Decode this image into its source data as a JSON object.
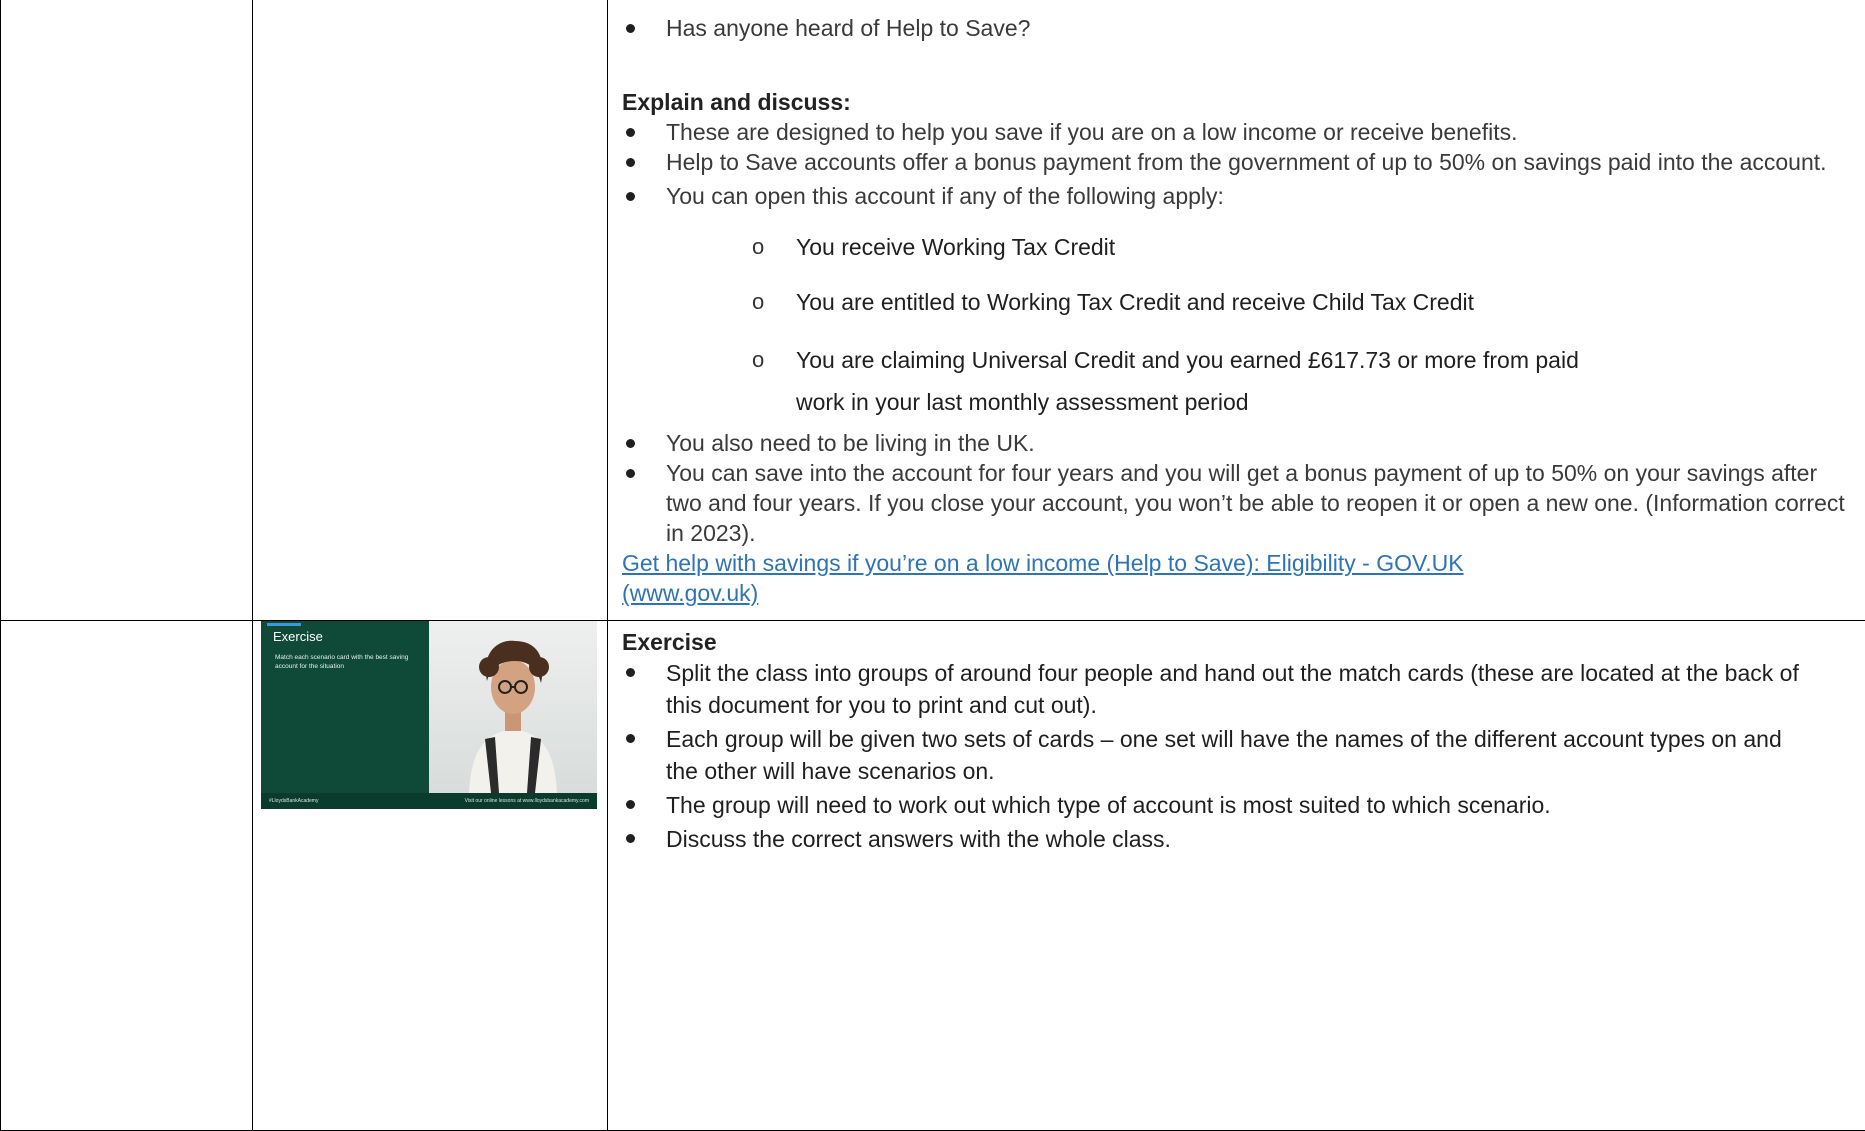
{
  "help_to_save": {
    "intro_bullet": "Has anyone heard of Help to Save?",
    "heading": "Explain and discuss:",
    "bullets": [
      "These are designed to help you save if you are on a low income or receive benefits.",
      "Help to Save accounts offer a bonus payment from the government of up to 50% on savings paid into the account.",
      "You can open this account if any of the following apply:"
    ],
    "conditions": [
      "You receive Working Tax Credit",
      "You are entitled to Working Tax Credit and receive Child Tax Credit",
      "You are claiming Universal Credit and you earned £617.73 or more from paid work in your last monthly assessment period"
    ],
    "more_bullets": [
      "You also need to be living in the UK.",
      "You can save into the account for four years and you will get a bonus payment of up to 50% on your savings after two and four years. If you close your account, you won’t be able to reopen it or open a new one. (Information correct in 2023)."
    ],
    "link_text": "Get help with savings if you’re on a low income (Help to Save): Eligibility - GOV.UK (www.gov.uk)"
  },
  "exercise": {
    "heading": "Exercise",
    "bullets": [
      "Split the class into groups of around four people and hand out the match cards (these are located at the back of this document for you to print and cut out).",
      "Each group will be given two sets of cards – one set will have the names of the different account types on and the other will have scenarios on.",
      "The group will need to work out which type of account is most suited to which scenario.",
      "Discuss the correct answers with the whole class."
    ],
    "slide": {
      "title": "Exercise",
      "bullet": "Match each scenario card with the best saving account for the situation",
      "footer_left": "#LloydsBankAcademy",
      "footer_right": "Visit our online lessons at www.lloydsbankacademy.com",
      "bg_color": "#0f4a38"
    }
  }
}
